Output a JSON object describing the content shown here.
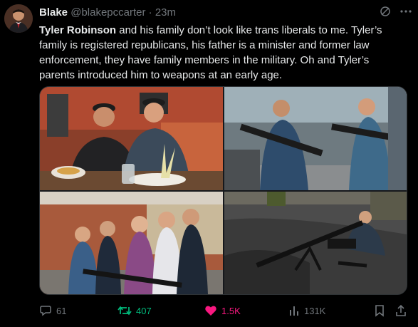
{
  "tweet": {
    "author_name": "Blake",
    "author_handle": "@blakepccarter",
    "separator": "·",
    "time": "23m",
    "text_bold": "Tyler Robinson",
    "text_rest": " and his family don’t look like trans liberals to me. Tyler’s family is registered republicans, his father is a minister and former law enforcement, they have family members in the military. Oh and Tyler’s parents introduced him to weapons at an early age."
  },
  "actions": {
    "replies": "61",
    "reposts": "407",
    "likes": "1.5K",
    "views": "131K"
  },
  "colors": {
    "background": "#000000",
    "text": "#e7e9ea",
    "muted": "#71767b",
    "repost_active": "#00ba7c",
    "like_active": "#f91880"
  },
  "icons": [
    "grok-icon",
    "more-icon",
    "reply-icon",
    "repost-icon",
    "like-icon",
    "views-icon",
    "bookmark-icon",
    "share-icon"
  ]
}
